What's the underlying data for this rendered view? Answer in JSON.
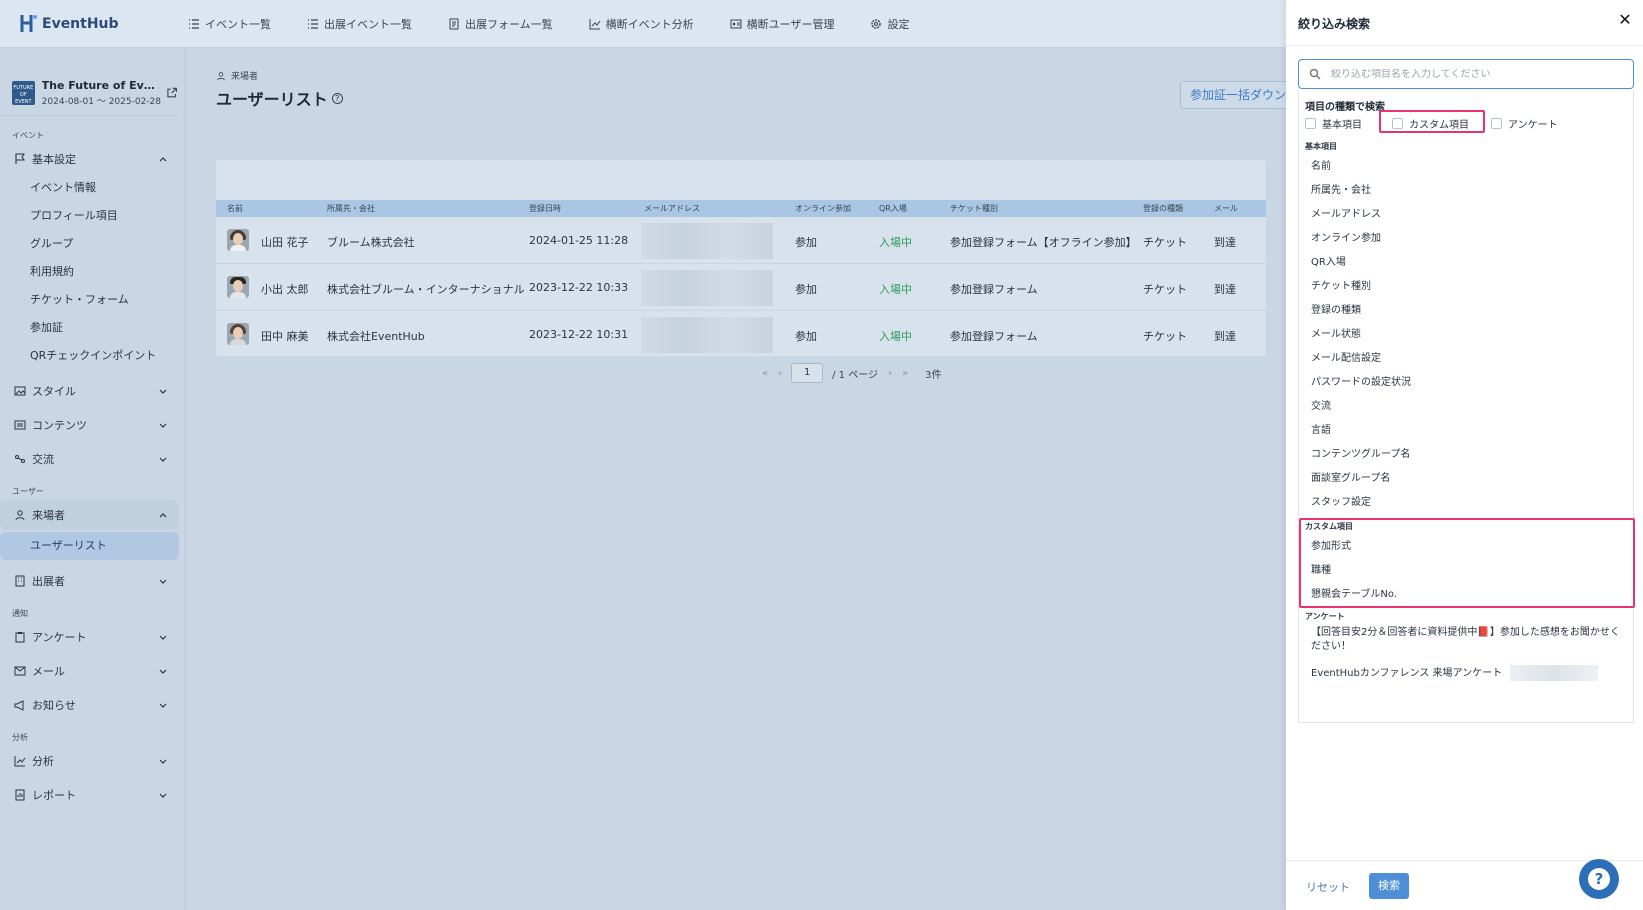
{
  "brand": {
    "name": "EventHub",
    "accent": "#3e7bc4",
    "highlight": "#e8336d"
  },
  "topnav": {
    "items": [
      {
        "icon": "list-icon",
        "label": "イベント一覧"
      },
      {
        "icon": "list-icon",
        "label": "出展イベント一覧"
      },
      {
        "icon": "form-icon",
        "label": "出展フォーム一覧"
      },
      {
        "icon": "chart-icon",
        "label": "横断イベント分析"
      },
      {
        "icon": "id-card-icon",
        "label": "横断ユーザー管理"
      },
      {
        "icon": "gear-icon",
        "label": "設定"
      }
    ]
  },
  "sidebar": {
    "event_thumb": "FUTURE OF EVENT",
    "event_title": "The Future of Eve...",
    "event_dates": "2024-08-01 〜 2025-02-28",
    "sec_event": "イベント",
    "basic_settings": "基本設定",
    "basic_sub": [
      "イベント情報",
      "プロフィール項目",
      "グループ",
      "利用規約",
      "チケット・フォーム",
      "参加証",
      "QRチェックインポイント"
    ],
    "style": "スタイル",
    "contents": "コンテンツ",
    "exchange": "交流",
    "sec_user": "ユーザー",
    "visitors": "来場者",
    "user_list": "ユーザーリスト",
    "exhibitors": "出展者",
    "sec_notify": "通知",
    "survey": "アンケート",
    "mail": "メール",
    "news": "お知らせ",
    "sec_analysis": "分析",
    "analysis": "分析",
    "report": "レポート"
  },
  "main": {
    "breadcrumb": "来場者",
    "title": "ユーザーリスト",
    "help": "?",
    "download_btn": "参加証一括ダウンロード",
    "columns": [
      "名前",
      "所属先・会社",
      "登録日時",
      "メールアドレス",
      "オンライン参加",
      "QR入場",
      "チケット種別",
      "登録の種類",
      "メール"
    ],
    "rows": [
      {
        "name": "山田 花子",
        "company": "ブルーム株式会社",
        "date": "2024-01-25 11:28",
        "online": "参加",
        "qr": "入場中",
        "ticket": "参加登録フォーム【オフライン参加】",
        "reg_type": "チケット",
        "mail": "到達"
      },
      {
        "name": "小出 太郎",
        "company": "株式会社ブルーム・インターナショナル",
        "date": "2023-12-22 10:33",
        "online": "参加",
        "qr": "入場中",
        "ticket": "参加登録フォーム",
        "reg_type": "チケット",
        "mail": "到達"
      },
      {
        "name": "田中 麻美",
        "company": "株式会社EventHub",
        "date": "2023-12-22 10:31",
        "online": "参加",
        "qr": "入場中",
        "ticket": "参加登録フォーム",
        "reg_type": "チケット",
        "mail": "到達"
      }
    ],
    "pager": {
      "page": "1",
      "of": "/ 1 ページ",
      "count": "3件"
    }
  },
  "drawer": {
    "title": "絞り込み検索",
    "close": "✕",
    "search_placeholder": "絞り込む項目名を入力してください",
    "type_label": "項目の種類で検索",
    "types": [
      "基本項目",
      "カスタム項目",
      "アンケート"
    ],
    "group_basic": "基本項目",
    "basic_options": [
      "名前",
      "所属先・会社",
      "メールアドレス",
      "オンライン参加",
      "QR入場",
      "チケット種別",
      "登録の種類",
      "メール状態",
      "メール配信設定",
      "パスワードの設定状況",
      "交流",
      "言語",
      "コンテンツグループ名",
      "面談室グループ名",
      "スタッフ設定"
    ],
    "group_custom": "カスタム項目",
    "custom_options": [
      "参加形式",
      "職種",
      "懇親会テーブルNo."
    ],
    "group_survey": "アンケート",
    "survey_options": [
      "【回答目安2分＆回答者に資料提供中📕】参加した感想をお聞かせください！",
      "EventHubカンファレンス 来場アンケート"
    ],
    "reset": "リセット",
    "search": "検索"
  },
  "help_fab": "?"
}
